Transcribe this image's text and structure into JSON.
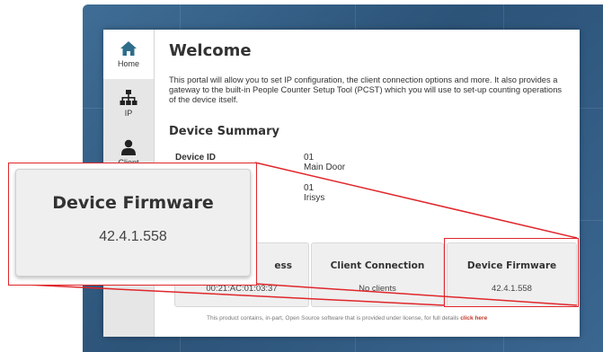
{
  "nav": {
    "home": "Home",
    "ip": "IP",
    "client": "Client"
  },
  "page": {
    "title": "Welcome",
    "intro": "This portal will allow you to set IP configuration, the client connection options and more. It also provides a gateway to the built-in People Counter Setup Tool (PCST) which you will use to set-up counting operations of the device itself."
  },
  "summary": {
    "heading": "Device Summary",
    "device_id_label": "Device ID",
    "device_id_value": "01",
    "device_id_value2": "Main Door",
    "second_value": "01",
    "second_value2": "Irisys"
  },
  "cards": {
    "mac_label_partial": "ess",
    "mac_value": "00:21:AC:01:03:37",
    "client_label": "Client Connection",
    "client_value": "No clients",
    "firmware_label": "Device Firmware",
    "firmware_value": "42.4.1.558"
  },
  "footer": {
    "text": "This product contains, in-part, Open Source software that is provided under license, for full details",
    "link": "click here"
  },
  "zoom": {
    "label": "Device Firmware",
    "value": "42.4.1.558"
  },
  "colors": {
    "accent": "#2f6e8a",
    "highlight": "#e0262b",
    "background": "#2c5378"
  }
}
